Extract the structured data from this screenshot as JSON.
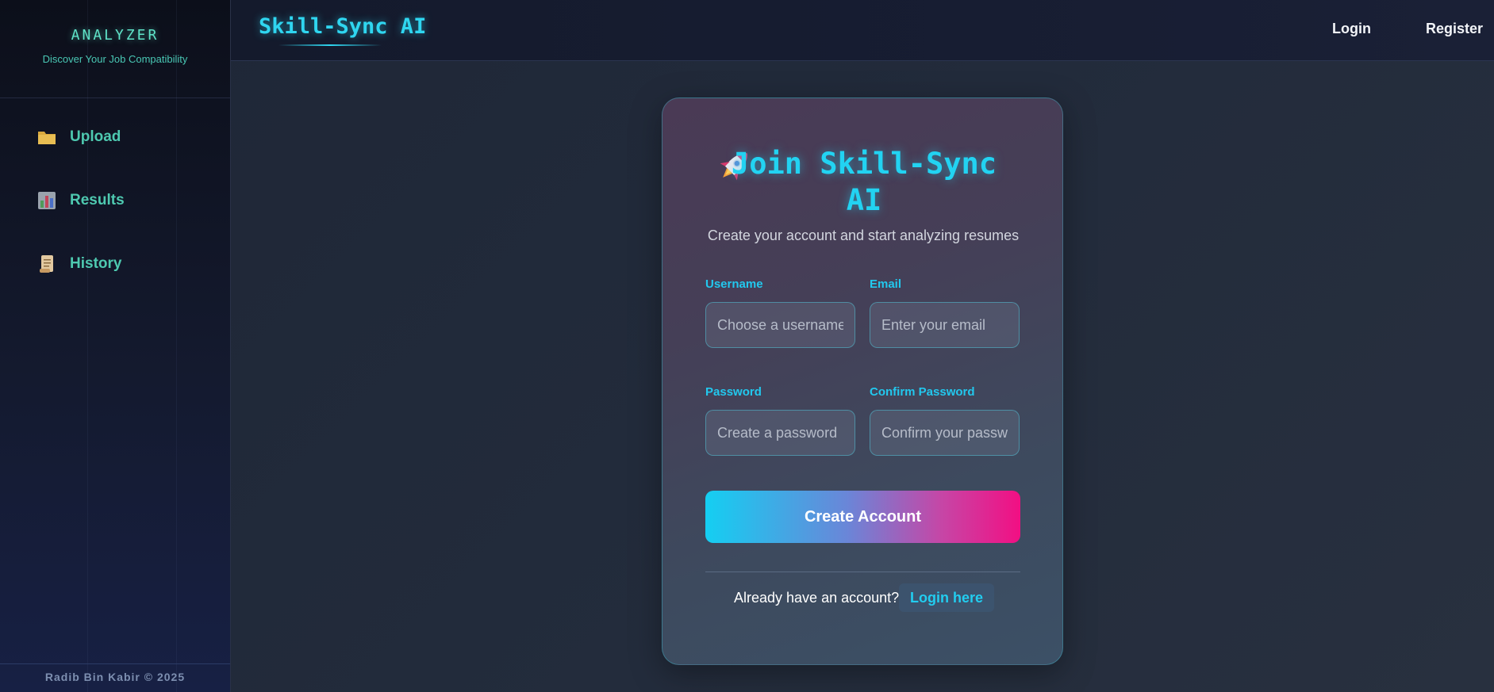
{
  "sidebar": {
    "brand": "ANALYZER",
    "tagline": "Discover Your Job Compatibility",
    "items": [
      {
        "label": "Upload",
        "icon": "folder-icon"
      },
      {
        "label": "Results",
        "icon": "bar-chart-icon"
      },
      {
        "label": "History",
        "icon": "scroll-icon"
      }
    ],
    "footer": "Radib Bin Kabir © 2025"
  },
  "header": {
    "logo": "Skill-Sync AI",
    "login": "Login",
    "register": "Register"
  },
  "form": {
    "title_icon": "rocket-icon",
    "title": "Join Skill-Sync AI",
    "subtitle": "Create your account and start analyzing resumes",
    "username": {
      "label": "Username",
      "placeholder": "Choose a username"
    },
    "email": {
      "label": "Email",
      "placeholder": "Enter your email"
    },
    "password": {
      "label": "Password",
      "placeholder": "Create a password"
    },
    "confirm": {
      "label": "Confirm Password",
      "placeholder": "Confirm your password"
    },
    "submit": "Create Account",
    "footer_text": "Already have an account?",
    "login_link": "Login here"
  },
  "colors": {
    "accent": "#22d3f2",
    "gradient_start": "#14cff2",
    "gradient_end": "#f20f83",
    "sidebar_text": "#4ec9b0"
  }
}
